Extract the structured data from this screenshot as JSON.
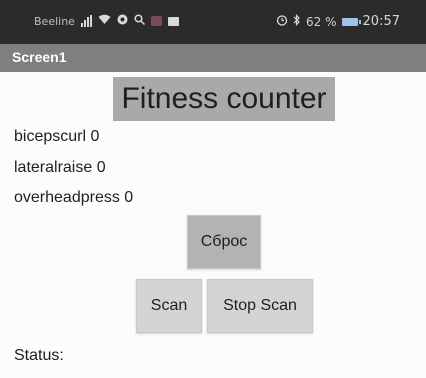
{
  "status_bar": {
    "carrier": "Beeline",
    "battery_text": "62 %",
    "time": "20:57",
    "icons": [
      "signal-icon",
      "wifi-icon",
      "app-icon",
      "search-icon",
      "app-badge-icon",
      "message-icon",
      "alarm-icon",
      "bluetooth-icon",
      "battery-icon"
    ]
  },
  "title_bar": {
    "title": "Screen1"
  },
  "main": {
    "heading": "Fitness counter",
    "counters": [
      "bicepscurl 0",
      "lateralraise 0",
      "overheadpress 0"
    ],
    "reset_button": "Сброс",
    "scan_button": "Scan",
    "stop_scan_button": "Stop Scan",
    "status_label": "Status:"
  },
  "colors": {
    "status_bar_bg": "#2b2b2b",
    "title_bar_bg": "#7f7f7f",
    "heading_bg": "#a9a9a9",
    "button_bg": "#d4d4d4",
    "reset_button_bg": "#b3b3b3",
    "battery": "#9ec0ea"
  }
}
